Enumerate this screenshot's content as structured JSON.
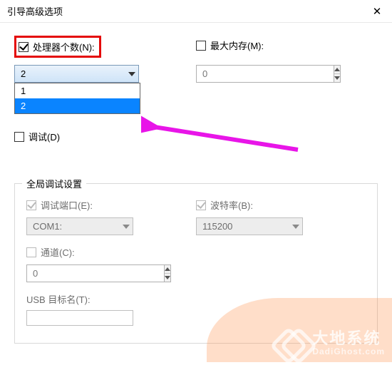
{
  "window": {
    "title": "引导高级选项",
    "close": "✕"
  },
  "left": {
    "processors_label": "处理器个数(N):",
    "processors_selected": "2",
    "processors_options": [
      "1",
      "2"
    ],
    "debug_label": "调试(D)"
  },
  "right": {
    "maxmem_label": "最大内存(M):",
    "maxmem_value": "0"
  },
  "group": {
    "legend": "全局调试设置",
    "debugport_label": "调试端口(E):",
    "debugport_value": "COM1:",
    "baud_label": "波特率(B):",
    "baud_value": "115200",
    "channel_label": "通道(C):",
    "channel_value": "0",
    "usb_label": "USB 目标名(T):"
  },
  "watermark": {
    "cn": "大地系统",
    "en": "DadiGhost.com"
  }
}
